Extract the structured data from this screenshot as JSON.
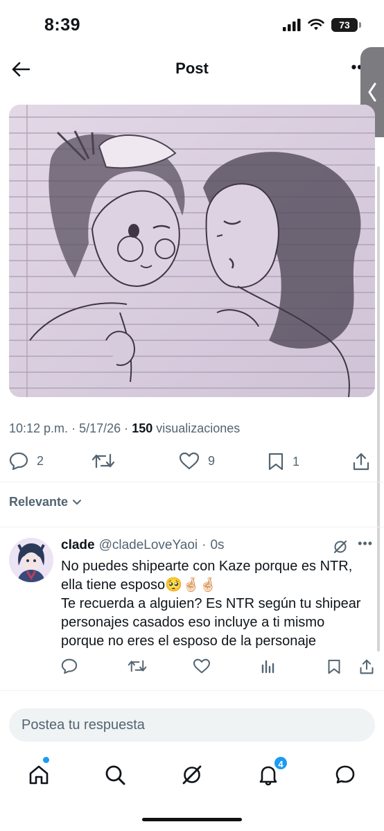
{
  "status_bar": {
    "time": "8:39",
    "battery": "73"
  },
  "header": {
    "title": "Post"
  },
  "post": {
    "image_alt": "",
    "time": "10:12 p.m.",
    "date": "5/17/26",
    "sep": "·",
    "views_count": "150",
    "views_label": "visualizaciones",
    "replies": "2",
    "reposts": "",
    "likes": "9",
    "bookmarks": "1"
  },
  "sort": {
    "label": "Relevante"
  },
  "reply": {
    "name": "clade",
    "handle": "@cladeLoveYaoi",
    "sep": "·",
    "age": "0s",
    "lines": [
      "No puedes shipearte con Kaze porque es NTR,",
      "ella tiene esposo🥺🤞🏻🤞🏻",
      "Te recuerda a alguien? Es NTR según tu shipear",
      "personajes casados eso incluye a ti mismo",
      "porque no eres el esposo de la personaje"
    ]
  },
  "compose": {
    "placeholder": "Postea tu respuesta"
  },
  "tabbar": {
    "notifications_badge": "4"
  },
  "colors": {
    "accent": "#1d9bf0",
    "secondary_text": "#536471",
    "paper": "#dcd2e0"
  }
}
